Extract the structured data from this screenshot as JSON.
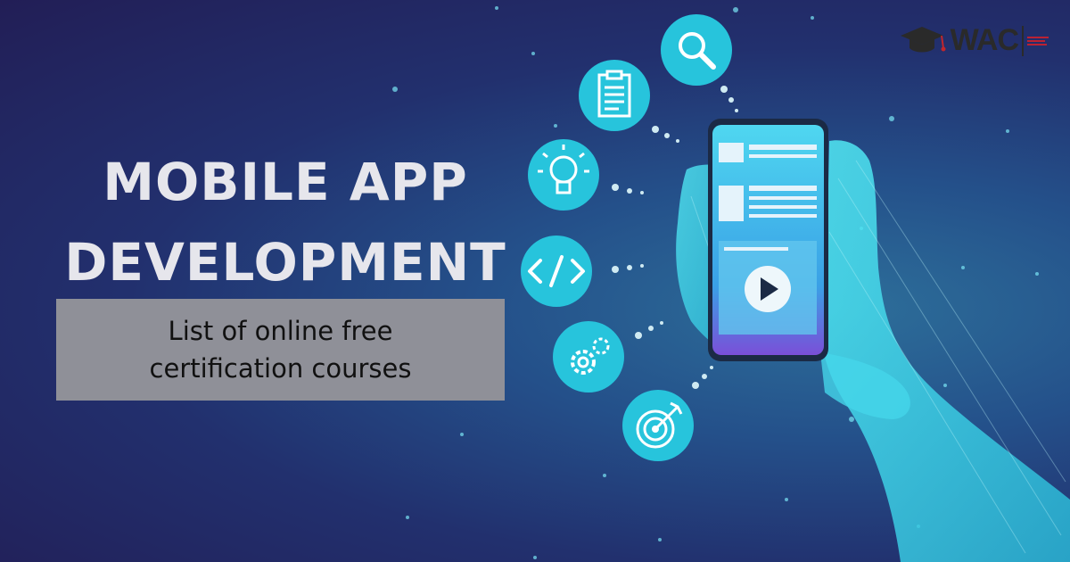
{
  "headline": {
    "line1": "MOBILE APP",
    "line2": "DEVELOPMENT"
  },
  "subtitle": {
    "line1": "List of online free",
    "line2": "certification courses"
  },
  "logo": {
    "text": "WAC",
    "icon": "graduation-cap-icon"
  },
  "icons": [
    "search-icon",
    "document-icon",
    "lightbulb-icon",
    "code-icon",
    "gears-icon",
    "target-icon"
  ],
  "phone": {
    "screen_icon": "play-icon"
  },
  "colors": {
    "background_dark": "#221e56",
    "background_light": "#2d6f9a",
    "icon_circle": "#27c4dc",
    "hand": "#3fe0ee",
    "subtitle_box": "#8f9098",
    "title_text": "#e6e6ec"
  }
}
